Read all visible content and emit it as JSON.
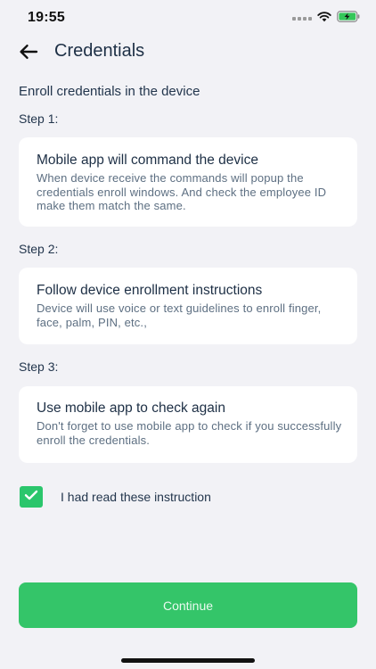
{
  "status_bar": {
    "time": "19:55"
  },
  "header": {
    "title": "Credentials",
    "back_icon": "arrow-left-icon"
  },
  "subtitle": "Enroll credentials in the device",
  "steps": [
    {
      "label": "Step 1:",
      "title": "Mobile app will command the device",
      "description": "When device receive the commands will popup the credentials enroll windows. And check the employee ID make them match the same."
    },
    {
      "label": "Step 2:",
      "title": "Follow device enrollment instructions",
      "description": "Device will use voice or text guidelines to enroll finger, face, palm, PIN, etc.,"
    },
    {
      "label": "Step 3:",
      "title": "Use mobile app to check again",
      "description": "Don't forget to use mobile app to check if you successfully enroll the credentials."
    }
  ],
  "agreement": {
    "label": "I had read these instruction",
    "checked": true
  },
  "continue_button": {
    "label": "Continue"
  },
  "colors": {
    "accent": "#34c569",
    "background": "#f2f2f6",
    "title_text": "#1d2f45",
    "body_text": "#5d6f82",
    "battery_green": "#34c759"
  }
}
